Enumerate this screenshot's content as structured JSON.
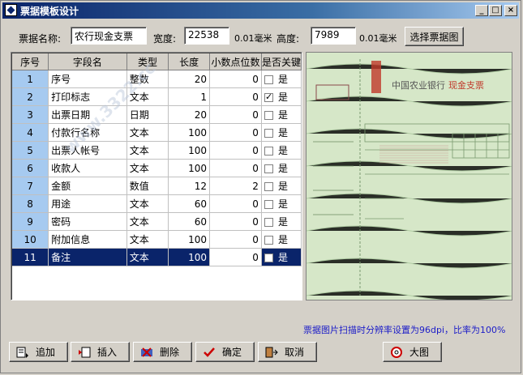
{
  "window": {
    "title": "票据模板设计",
    "minimize": "_",
    "maximize": "□",
    "close": "×"
  },
  "form": {
    "name_label": "票据名称:",
    "name_value": "农行现金支票",
    "width_label": "宽度:",
    "width_value": "22538",
    "width_unit": "0.01毫米",
    "height_label": "高度:",
    "height_value": "7989",
    "height_unit": "0.01毫米",
    "select_image_button": "选择票据图"
  },
  "grid": {
    "columns": [
      "序号",
      "字段名",
      "类型",
      "长度",
      "小数点位数",
      "是否关键"
    ],
    "rows": [
      {
        "no": "1",
        "name": "序号",
        "type": "整数",
        "length": "20",
        "decimals": "0",
        "key_checked": false,
        "key_label": "是"
      },
      {
        "no": "2",
        "name": "打印标志",
        "type": "文本",
        "length": "1",
        "decimals": "0",
        "key_checked": true,
        "key_label": "是"
      },
      {
        "no": "3",
        "name": "出票日期",
        "type": "日期",
        "length": "20",
        "decimals": "0",
        "key_checked": false,
        "key_label": "是"
      },
      {
        "no": "4",
        "name": "付款行名称",
        "type": "文本",
        "length": "100",
        "decimals": "0",
        "key_checked": false,
        "key_label": "是"
      },
      {
        "no": "5",
        "name": "出票人帐号",
        "type": "文本",
        "length": "100",
        "decimals": "0",
        "key_checked": false,
        "key_label": "是"
      },
      {
        "no": "6",
        "name": "收款人",
        "type": "文本",
        "length": "100",
        "decimals": "0",
        "key_checked": false,
        "key_label": "是"
      },
      {
        "no": "7",
        "name": "金额",
        "type": "数值",
        "length": "12",
        "decimals": "2",
        "key_checked": false,
        "key_label": "是"
      },
      {
        "no": "8",
        "name": "用途",
        "type": "文本",
        "length": "60",
        "decimals": "0",
        "key_checked": false,
        "key_label": "是"
      },
      {
        "no": "9",
        "name": "密码",
        "type": "文本",
        "length": "60",
        "decimals": "0",
        "key_checked": false,
        "key_label": "是"
      },
      {
        "no": "10",
        "name": "附加信息",
        "type": "文本",
        "length": "100",
        "decimals": "0",
        "key_checked": false,
        "key_label": "是"
      },
      {
        "no": "11",
        "name": "备注",
        "type": "文本",
        "length": "100",
        "decimals": "0",
        "key_checked": false,
        "key_label": "是"
      }
    ],
    "selected_row": 11
  },
  "preview": {
    "cheque_title": "中国农业银行",
    "cheque_kind": "现金支票"
  },
  "hint": "票据图片扫描时分辨率设置为96dpi，比率为100%",
  "toolbar": {
    "add": "追加",
    "insert": "插入",
    "delete": "删除",
    "confirm": "确定",
    "cancel": "取消",
    "big_image": "大图"
  },
  "watermark": "www.3322.cc",
  "colors": {
    "title_bar": "#0a246a",
    "selection": "#0a246a",
    "index_cell": "#a6caf0",
    "hint_text": "#1c1cc8",
    "cheque_bg": "#d6e7c8"
  }
}
